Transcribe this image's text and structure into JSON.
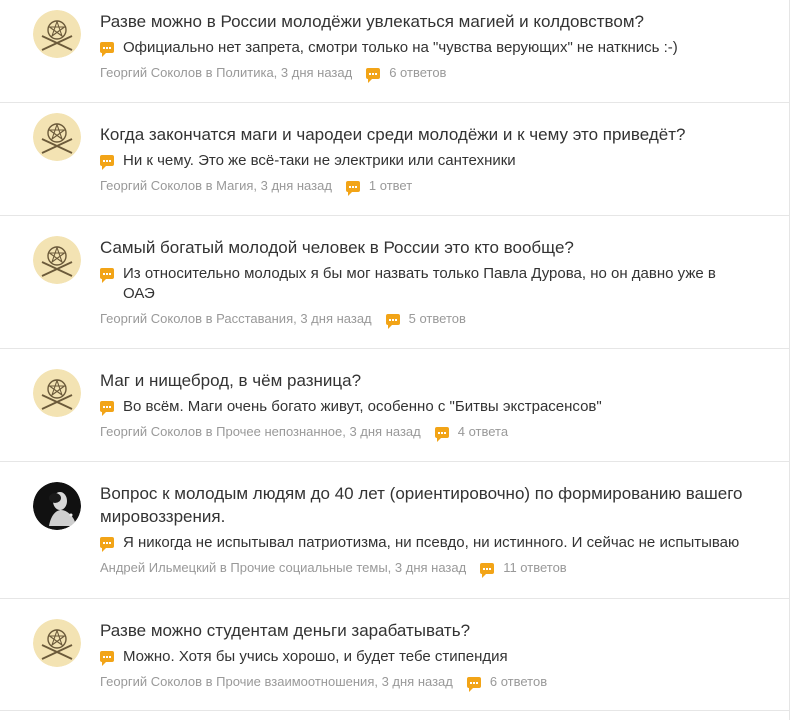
{
  "feed": [
    {
      "avatar": "pentagram-avatar",
      "title": "Разве можно в России молодёжи увлекаться магией и колдовством?",
      "answer": "Официально нет запрета, смотри только на \"чувства верующих\" не наткнись :-)",
      "meta": "Георгий Соколов в Политика, 3 дня назад",
      "replies": "6 ответов"
    },
    {
      "avatar": "pentagram-avatar",
      "title": "Когда закончатся маги и чародеи среди молодёжи и к чему это приведёт?",
      "answer": "Ни к чему. Это же всё-таки не электрики или сантехники",
      "meta": "Георгий Соколов в Магия, 3 дня назад",
      "replies": "1 ответ"
    },
    {
      "avatar": "pentagram-avatar",
      "title": "Самый богатый молодой человек в России это кто вообще?",
      "answer": "Из относительно молодых я бы мог назвать только Павла Дурова, но он давно уже в ОАЭ",
      "meta": "Георгий Соколов в Расставания, 3 дня назад",
      "replies": "5 ответов"
    },
    {
      "avatar": "pentagram-avatar",
      "title": "Маг и нищеброд, в чём разница?",
      "answer": "Во всём. Маги очень богато живут, особенно с \"Битвы экстрасенсов\"",
      "meta": "Георгий Соколов в Прочее непознанное, 3 дня назад",
      "replies": "4 ответа"
    },
    {
      "avatar": "photo-avatar",
      "title": "Вопрос к молодым людям до 40 лет (ориентировочно) по формированию вашего мировоззрения.",
      "answer": "Я никогда не испытывал патриотизма, ни псевдо, ни истинного. И сейчас не испытываю",
      "meta": "Андрей Ильмецкий в Прочие социальные темы, 3 дня назад",
      "replies": "11 ответов"
    },
    {
      "avatar": "pentagram-avatar",
      "title": "Разве можно студентам деньги зарабатывать?",
      "answer": "Можно. Хотя бы учись хорошо, и будет тебе стипендия",
      "meta": "Георгий Соколов в Прочие взаимоотношения, 3 дня назад",
      "replies": "6 ответов"
    }
  ],
  "colors": {
    "accent": "#f2a417",
    "text": "#333333",
    "muted": "#999999",
    "avatar_bg": "#f3e3b3"
  }
}
